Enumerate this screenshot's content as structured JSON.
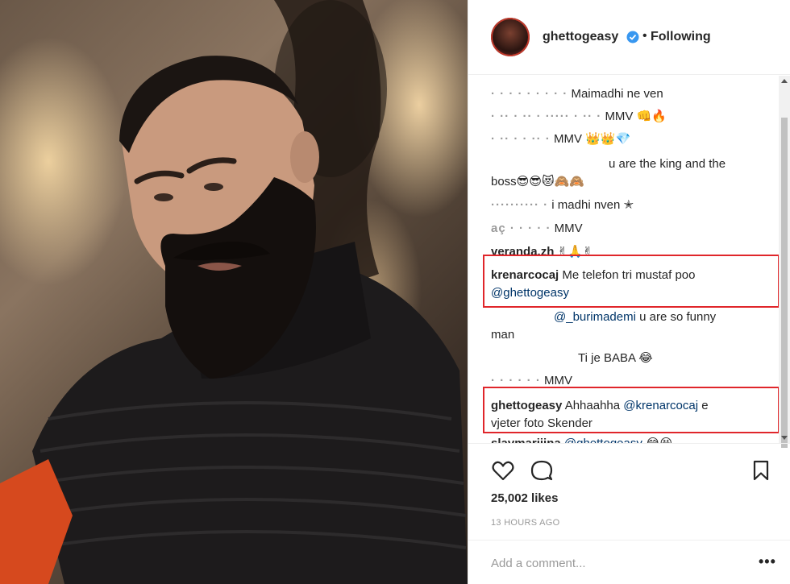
{
  "post": {
    "username": "ghettogeasy",
    "separator": "•",
    "follow_label": "Following",
    "likes": "25,002 likes",
    "time_ago": "13 HOURS AGO",
    "add_comment_placeholder": "Add a comment...",
    "more_label": "•••"
  },
  "comments": [
    {
      "user": "· · · · · · · · ·",
      "text": "Maimadhi ne ven"
    },
    {
      "user": "· ·· · ·· · ····· · ·· ·",
      "text": "MMV 👊🔥"
    },
    {
      "user": "· ·· · · ·· ·",
      "text": "MMV 👑👑💎"
    },
    {
      "user": "",
      "text": "u are the king and the",
      "text2": "boss😎😎😻🙈🙈"
    },
    {
      "user": "·········· ·",
      "text": "i madhi nven ✭"
    },
    {
      "user": "aç · · · · ·",
      "text": "MMV"
    },
    {
      "user": "veranda.zh",
      "text": "✌🙏✌"
    },
    {
      "user": "krenarcocaj",
      "text": "Me telefon tri mustaf poo",
      "mention": "@ghettogeasy"
    },
    {
      "user": "",
      "mention": "@_burimademi",
      "text": "u are so funny",
      "text2": "man"
    },
    {
      "user": "",
      "text": "Ti je BABA 😂"
    },
    {
      "user": "· · · · · ·",
      "text": "MMV"
    },
    {
      "user": "ghettogeasy",
      "text": "Ahhaahha",
      "mention": "@krenarcocaj",
      "text_after": "e",
      "text2": "vjeter foto Skender"
    },
    {
      "user": "slavmarijina",
      "mention": "@ghettogeasy",
      "text": "😂😆"
    }
  ],
  "icons": {
    "verified": "verified-badge-icon",
    "like": "heart-icon",
    "comment": "comment-bubble-icon",
    "save": "bookmark-icon"
  },
  "colors": {
    "accent": "#3897f0",
    "highlight_box": "#e0262b",
    "mention": "#003569"
  }
}
